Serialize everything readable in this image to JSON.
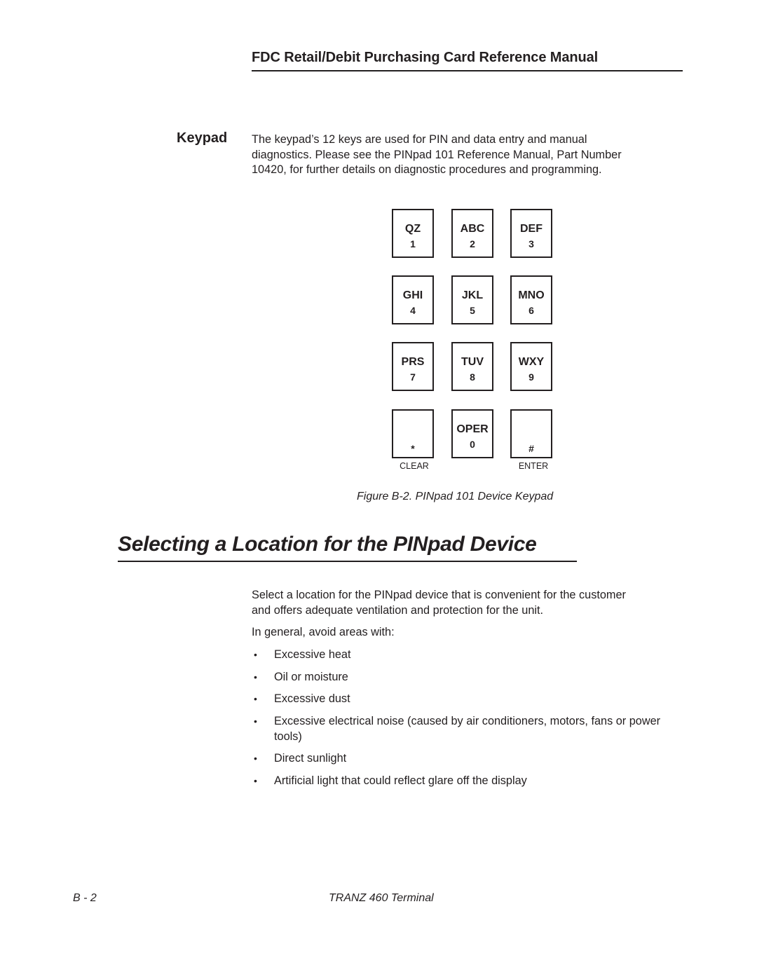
{
  "header": {
    "title": "FDC Retail/Debit Purchasing Card Reference Manual"
  },
  "keypad_section": {
    "side_heading": "Keypad",
    "intro_lines": [
      "The keypad’s 12 keys are used for PIN and data entry and manual",
      "diagnostics. Please see the PINpad 101 Reference Manual, Part Number",
      "10420, for further details on diagnostic procedures and programming."
    ]
  },
  "keypad": {
    "keys": [
      {
        "letters": "QZ",
        "digit": "1"
      },
      {
        "letters": "ABC",
        "digit": "2"
      },
      {
        "letters": "DEF",
        "digit": "3"
      },
      {
        "letters": "GHI",
        "digit": "4"
      },
      {
        "letters": "JKL",
        "digit": "5"
      },
      {
        "letters": "MNO",
        "digit": "6"
      },
      {
        "letters": "PRS",
        "digit": "7"
      },
      {
        "letters": "TUV",
        "digit": "8"
      },
      {
        "letters": "WXY",
        "digit": "9"
      },
      {
        "letters": "",
        "digit": "*",
        "caption": "CLEAR"
      },
      {
        "letters": "OPER",
        "digit": "0"
      },
      {
        "letters": "",
        "digit": "#",
        "caption": "ENTER"
      }
    ]
  },
  "figure": {
    "caption": "Figure B-2.  PINpad 101 Device Keypad"
  },
  "location_section": {
    "title": "Selecting a Location for the PINpad Device",
    "paragraph_lines": [
      "Select a location for the PINpad device that is convenient for the customer",
      "and offers adequate ventilation and protection for the unit."
    ],
    "avoid_intro": "In general, avoid areas with:",
    "bullet_symbol": "•",
    "bullets": [
      "Excessive heat",
      "Oil or moisture",
      "Excessive dust",
      "Excessive electrical noise (caused by air conditioners, motors, fans or power tools)",
      "Direct sunlight",
      "Artificial light that could reflect glare off the display"
    ]
  },
  "footer": {
    "page_number": "B - 2",
    "product": "TRANZ 460 Terminal"
  }
}
